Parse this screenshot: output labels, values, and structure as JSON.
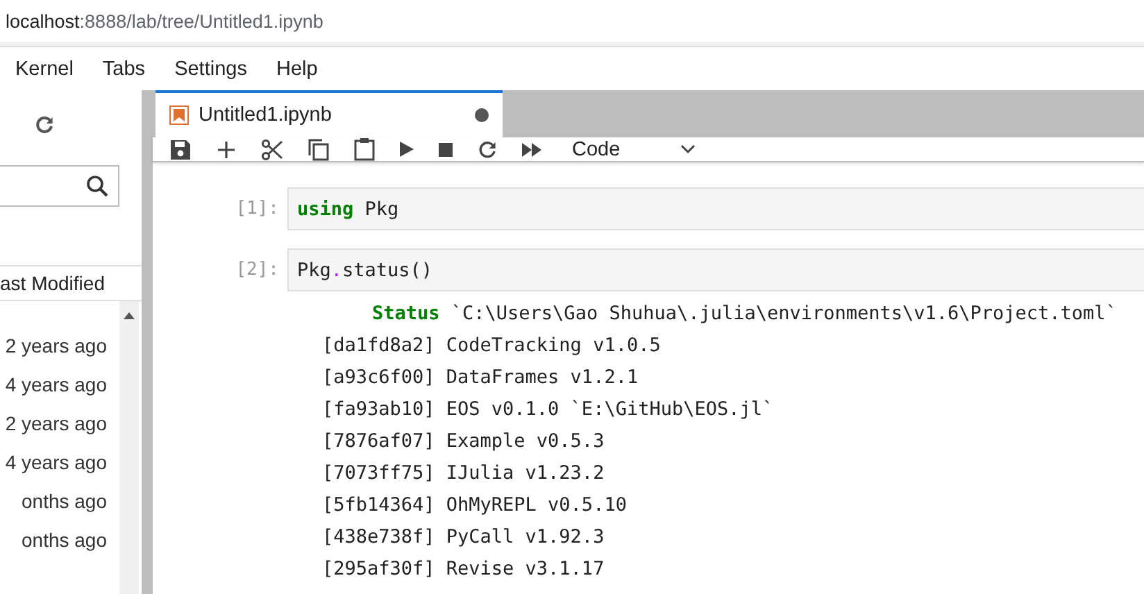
{
  "address_bar": {
    "host": "localhost",
    "path": ":8888/lab/tree/Untitled1.ipynb"
  },
  "menu": [
    "Kernel",
    "Tabs",
    "Settings",
    "Help"
  ],
  "file_browser": {
    "column_header": "ast Modified",
    "rows": [
      "2 years ago",
      "4 years ago",
      "2 years ago",
      "4 years ago",
      "onths ago",
      "onths ago"
    ]
  },
  "tab": {
    "title": "Untitled1.ipynb",
    "dirty": true,
    "selected": true
  },
  "toolbar": {
    "cell_type": "Code"
  },
  "cells": [
    {
      "prompt": "[1]:",
      "code": [
        {
          "text": "using",
          "kind": "keyword"
        },
        {
          "text": " Pkg",
          "kind": "plain"
        }
      ]
    },
    {
      "prompt": "[2]:",
      "code": [
        {
          "text": "Pkg",
          "kind": "plain"
        },
        {
          "text": ".",
          "kind": "operator"
        },
        {
          "text": "status()",
          "kind": "plain"
        }
      ],
      "output": [
        {
          "kind": "header",
          "parts": [
            {
              "text": "Status",
              "kind": "keyword"
            },
            {
              "text": " `C:\\Users\\Gao Shuhua\\.julia\\environments\\v1.6\\Project.toml`",
              "kind": "plain"
            }
          ]
        },
        {
          "kind": "entry",
          "parts": [
            {
              "text": "[da1fd8a2] CodeTracking v1.0.5",
              "kind": "plain"
            }
          ]
        },
        {
          "kind": "entry",
          "parts": [
            {
              "text": "[a93c6f00] DataFrames v1.2.1",
              "kind": "plain"
            }
          ]
        },
        {
          "kind": "entry",
          "parts": [
            {
              "text": "[fa93ab10] EOS v0.1.0 `E:\\GitHub\\EOS.jl`",
              "kind": "plain"
            }
          ]
        },
        {
          "kind": "entry",
          "parts": [
            {
              "text": "[7876af07] Example v0.5.3",
              "kind": "plain"
            }
          ]
        },
        {
          "kind": "entry",
          "parts": [
            {
              "text": "[7073ff75] IJulia v1.23.2",
              "kind": "plain"
            }
          ]
        },
        {
          "kind": "entry",
          "parts": [
            {
              "text": "[5fb14364] OhMyREPL v0.5.10",
              "kind": "plain"
            }
          ]
        },
        {
          "kind": "entry",
          "parts": [
            {
              "text": "[438e738f] PyCall v1.92.3",
              "kind": "plain"
            }
          ]
        },
        {
          "kind": "entry",
          "parts": [
            {
              "text": "[295af30f] Revise v3.1.17",
              "kind": "plain"
            }
          ]
        }
      ]
    }
  ]
}
